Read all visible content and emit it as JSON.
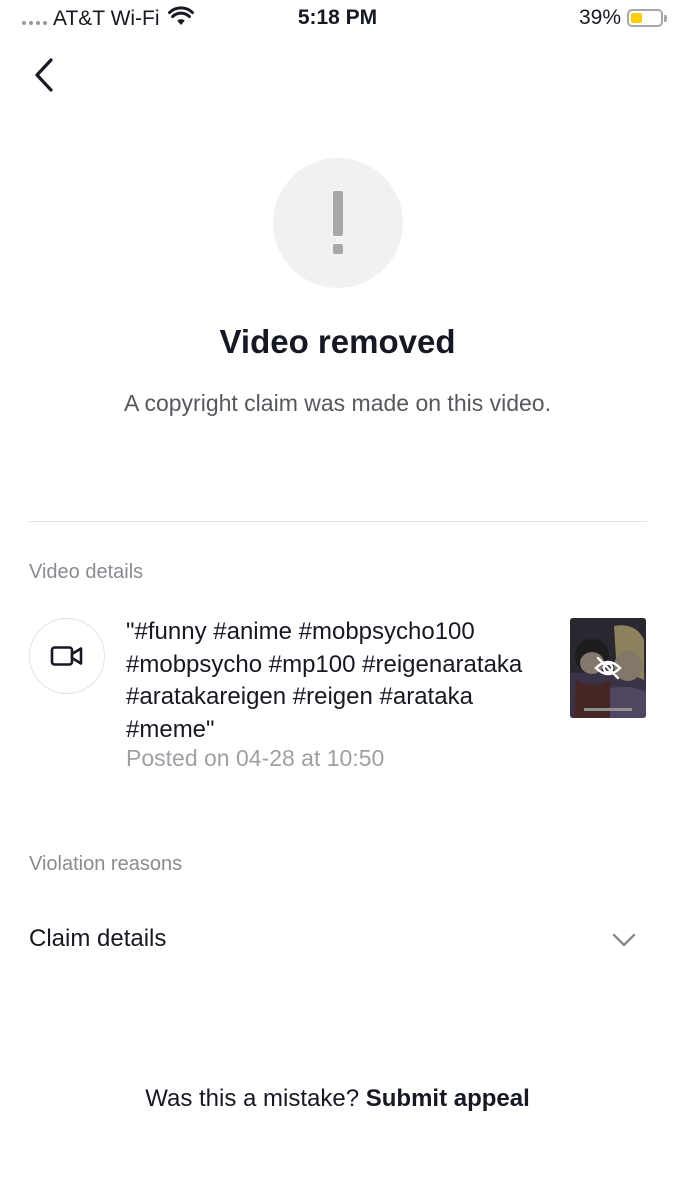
{
  "status_bar": {
    "carrier": "AT&T Wi-Fi",
    "time": "5:18 PM",
    "battery_percent": "39%",
    "battery_level": 0.39,
    "battery_color": "#ffcc00"
  },
  "header": {
    "back_icon": "chevron-left-icon"
  },
  "notice": {
    "icon": "exclamation-icon",
    "title": "Video removed",
    "message": "A copyright claim was made on this video."
  },
  "video_details": {
    "label": "Video details",
    "icon": "video-camera-icon",
    "caption": "\"#funny #anime #mobpsycho100 #mobpsycho #mp100 #reigenarataka #aratakareigen #reigen #arataka #meme\"",
    "posted": "Posted on 04-28 at 10:50",
    "thumbnail_icon": "eye-slash-icon"
  },
  "violation": {
    "label": "Violation reasons",
    "claim_label": "Claim details",
    "expand_icon": "chevron-down-icon"
  },
  "footer": {
    "question": "Was this a mistake?",
    "appeal_label": "Submit appeal"
  }
}
